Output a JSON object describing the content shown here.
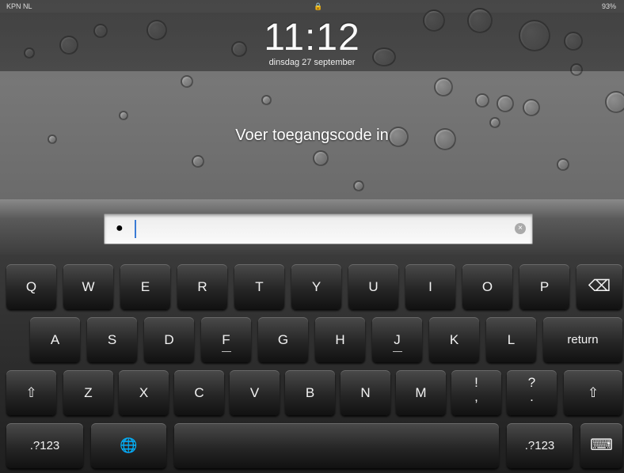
{
  "status_bar": {
    "carrier": "KPN NL",
    "lock": "🔒",
    "battery": "93%"
  },
  "lock_screen": {
    "time": "11:12",
    "date": "dinsdag 27 september",
    "prompt": "Voer toegangscode in"
  },
  "passcode_field": {
    "value": "●",
    "clear_icon": "⊗"
  },
  "keyboard": {
    "row1": [
      "Q",
      "W",
      "E",
      "R",
      "T",
      "Y",
      "U",
      "I",
      "O",
      "P"
    ],
    "backspace": "⌫",
    "row2": [
      "A",
      "S",
      "D",
      "F",
      "G",
      "H",
      "J",
      "K",
      "L"
    ],
    "return": "return",
    "shift": "⇧",
    "row3": [
      "Z",
      "X",
      "C",
      "V",
      "B",
      "N",
      "M"
    ],
    "punct1": [
      "!",
      ","
    ],
    "punct2": [
      "?",
      "."
    ],
    "numbers": ".?123",
    "globe": "🌐",
    "hide_keyboard": "⌨"
  }
}
